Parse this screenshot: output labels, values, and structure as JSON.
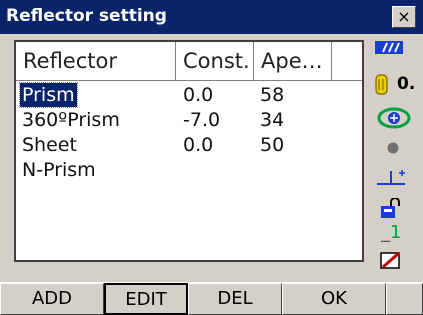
{
  "window": {
    "title": "Reflector setting",
    "close_label": "×"
  },
  "list": {
    "columns": [
      "Reflector",
      "Const.",
      "Ape…",
      ""
    ],
    "rows": [
      {
        "name": "Prism",
        "const": "0.0",
        "ape": "58"
      },
      {
        "name": "360ºPrism",
        "const": "-7.0",
        "ape": "34"
      },
      {
        "name": "Sheet",
        "const": "0.0",
        "ape": "50"
      },
      {
        "name": "N-Prism",
        "const": "",
        "ape": ""
      }
    ]
  },
  "sidebar": {
    "ppm_value": "0.",
    "counter_value": "1"
  },
  "buttons": {
    "add": "ADD",
    "edit": "EDIT",
    "del": "DEL",
    "ok": "OK",
    "blank": ""
  },
  "colors": {
    "titlebar": "#0a246a",
    "selection": "#0a246a",
    "accent_blue": "#1a3fd0",
    "accent_green": "#00a040"
  }
}
